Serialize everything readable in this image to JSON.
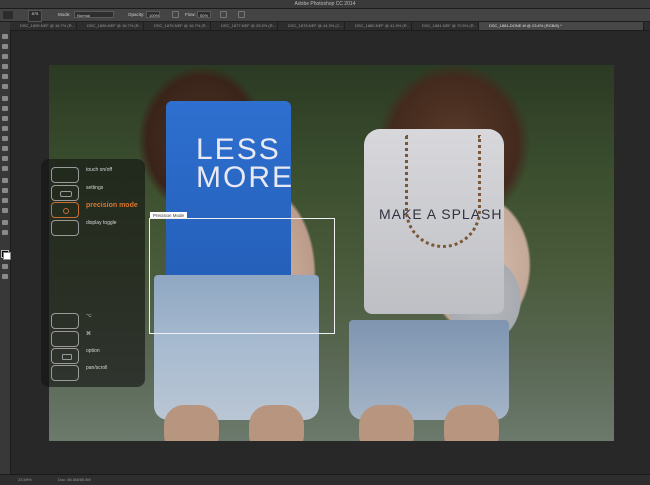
{
  "window": {
    "title": "Adobe Photoshop CC 2014"
  },
  "options_bar": {
    "brush_size": "875",
    "mode_label": "Mode:",
    "mode_value": "Normal",
    "opacity_label": "Opacity:",
    "opacity_value": "100%",
    "flow_label": "Flow:",
    "flow_value": "50%"
  },
  "tabs": [
    {
      "label": "DSC_1895.NEF @ 16.7% (R...",
      "active": false
    },
    {
      "label": "DSC_1896.NEF @ 16.7% (R...",
      "active": false
    },
    {
      "label": "DSC_1876.NEF @ 16.7% (R...",
      "active": false
    },
    {
      "label": "DSC_1877.NEF @ 25.5% (R...",
      "active": false
    },
    {
      "label": "DSC_1878.NEF @ 44.3% (C...",
      "active": false
    },
    {
      "label": "DSC_1880.NEF @ 41.3% (R...",
      "active": false
    },
    {
      "label": "DSC_1881.NEF @ 70.5% (R...",
      "active": false
    },
    {
      "label": "DSC_1881-DONE.tif @ 23.6% (RGB/8) *",
      "active": true
    }
  ],
  "canvas": {
    "shirt_left_text": "LESS\nMORE",
    "shirt_right_text": "MAKE A SPLASH"
  },
  "precision_mode": {
    "label": "Precision Mode"
  },
  "overlay": {
    "top_keys": [
      {
        "label": "touch on/off",
        "active": false
      },
      {
        "label": "settings",
        "active": false
      },
      {
        "label": "precision mode",
        "active": true
      },
      {
        "label": "display toggle",
        "active": false
      }
    ],
    "bottom_keys": [
      {
        "label": "⌥"
      },
      {
        "label": "⌘"
      },
      {
        "label": "option"
      },
      {
        "label": "pan/scroll"
      }
    ]
  },
  "status_bar": {
    "zoom": "23.59%",
    "doc": "Doc: 85.5M/85.5M"
  }
}
